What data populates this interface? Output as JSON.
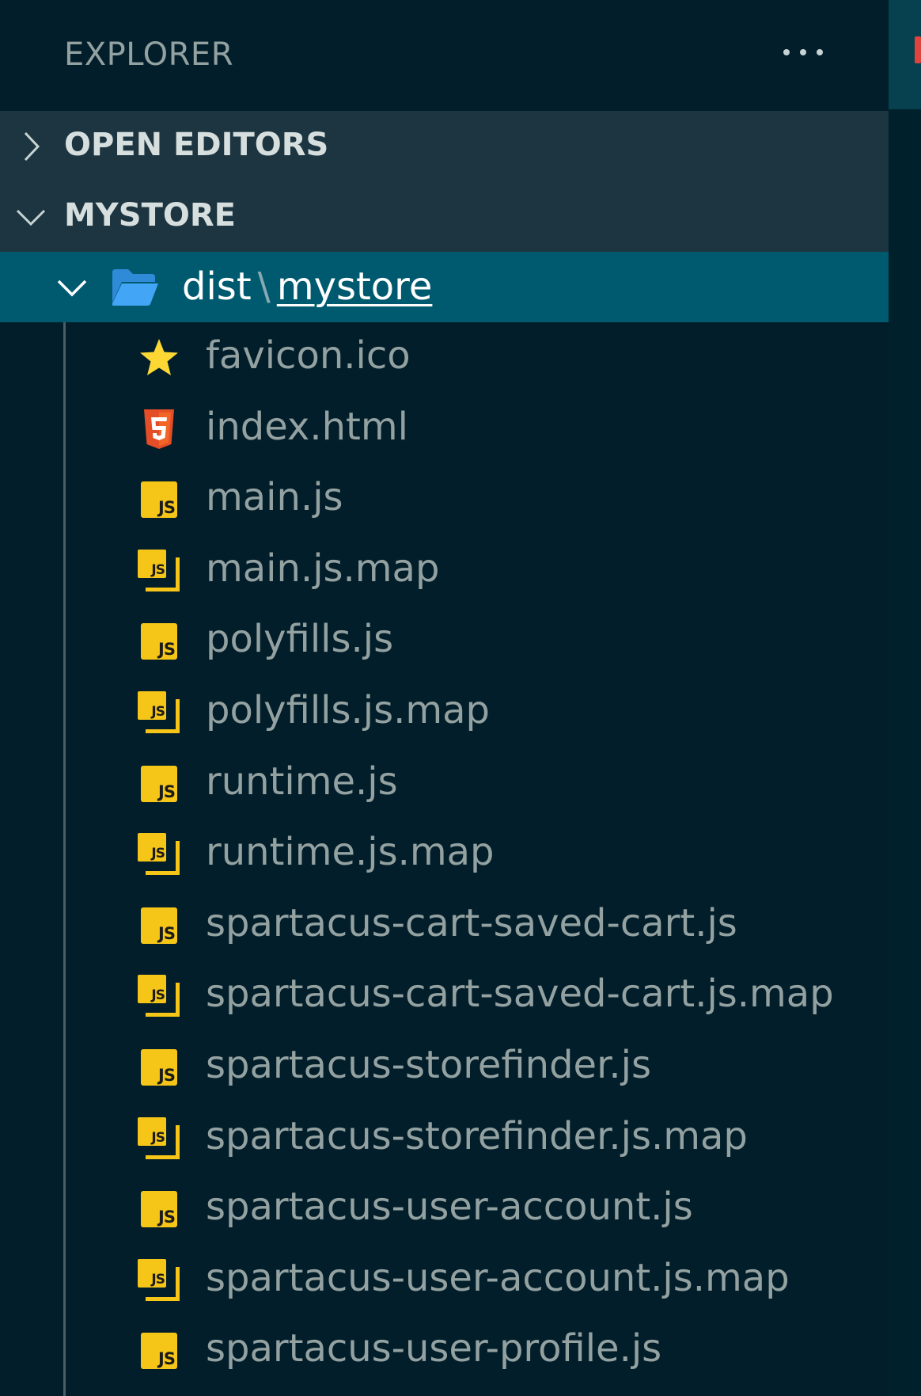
{
  "header": {
    "title": "EXPLORER"
  },
  "sections": {
    "open_editors": "OPEN EDITORS",
    "workspace": "MYSTORE"
  },
  "folder": {
    "parent": "dist",
    "separator": "\\",
    "child": "mystore"
  },
  "files": [
    {
      "name": "favicon.ico",
      "icon": "star-icon"
    },
    {
      "name": "index.html",
      "icon": "html5-icon"
    },
    {
      "name": "main.js",
      "icon": "js-icon"
    },
    {
      "name": "main.js.map",
      "icon": "js-map-icon"
    },
    {
      "name": "polyfills.js",
      "icon": "js-icon"
    },
    {
      "name": "polyfills.js.map",
      "icon": "js-map-icon"
    },
    {
      "name": "runtime.js",
      "icon": "js-icon"
    },
    {
      "name": "runtime.js.map",
      "icon": "js-map-icon"
    },
    {
      "name": "spartacus-cart-saved-cart.js",
      "icon": "js-icon"
    },
    {
      "name": "spartacus-cart-saved-cart.js.map",
      "icon": "js-map-icon"
    },
    {
      "name": "spartacus-storefinder.js",
      "icon": "js-icon"
    },
    {
      "name": "spartacus-storefinder.js.map",
      "icon": "js-map-icon"
    },
    {
      "name": "spartacus-user-account.js",
      "icon": "js-icon"
    },
    {
      "name": "spartacus-user-account.js.map",
      "icon": "js-map-icon"
    },
    {
      "name": "spartacus-user-profile.js",
      "icon": "js-icon"
    }
  ],
  "icon_text": {
    "js": "JS"
  },
  "colors": {
    "sidebar_bg": "#021e2a",
    "section_bg": "#1c3540",
    "selected_bg": "#005a6f",
    "file_text": "#93a1a1",
    "js_yellow": "#f5c518",
    "html_orange": "#e44d26",
    "star_yellow": "#fdd835",
    "folder_blue": "#42a5f5"
  }
}
